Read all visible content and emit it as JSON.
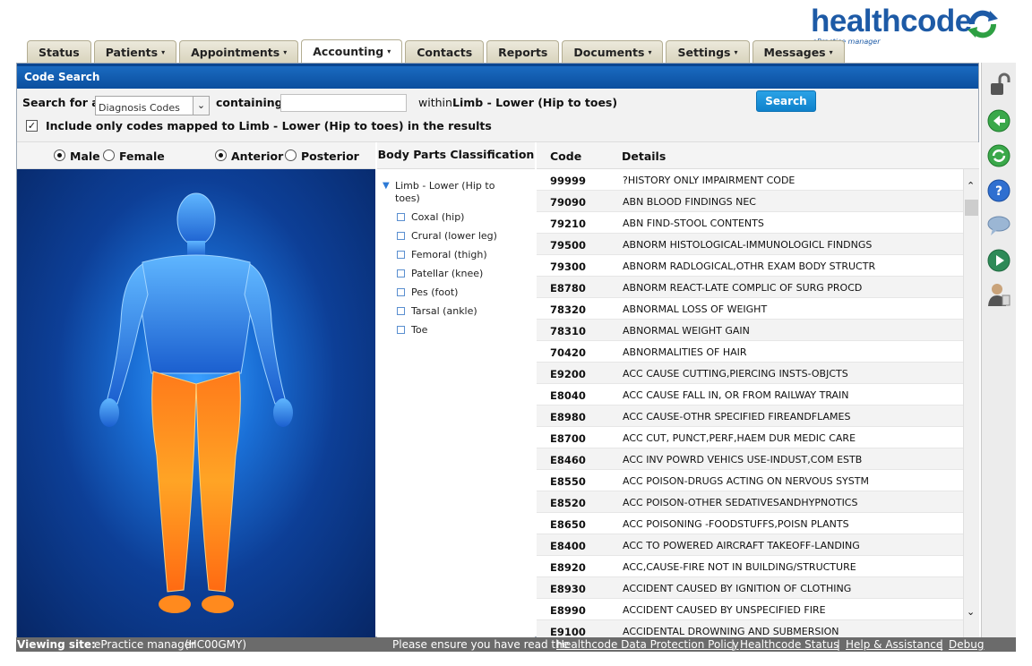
{
  "brand": {
    "name": "healthcode",
    "tagline": "ePractice manager",
    "colors": {
      "primary": "#1d5aa6",
      "accent": "#2ea043"
    }
  },
  "tabs": [
    {
      "label": "Status",
      "caret": false
    },
    {
      "label": "Patients",
      "caret": true
    },
    {
      "label": "Appointments",
      "caret": true
    },
    {
      "label": "Accounting",
      "caret": true,
      "active": true
    },
    {
      "label": "Contacts",
      "caret": false
    },
    {
      "label": "Reports",
      "caret": false
    },
    {
      "label": "Documents",
      "caret": true
    },
    {
      "label": "Settings",
      "caret": true
    },
    {
      "label": "Messages",
      "caret": true
    }
  ],
  "panel": {
    "title": "Code Search"
  },
  "search": {
    "search_for_label": "Search for a",
    "code_type_value": "Diagnosis Codes",
    "containing_label": "containing",
    "containing_value": "",
    "within_label": "within",
    "within_value": "Limb - Lower  (Hip to toes)",
    "button_label": "Search",
    "include_only_checked": true,
    "include_only_label": "Include only codes mapped to Limb - Lower  (Hip to toes) in the results"
  },
  "view": {
    "male_label": "Male",
    "female_label": "Female",
    "anterior_label": "Anterior",
    "posterior_label": "Posterior",
    "selected_gender": "male",
    "selected_view": "anterior"
  },
  "body_parts": {
    "header": "Body Parts Classification",
    "root": "Limb - Lower  (Hip to toes)",
    "items": [
      "Coxal (hip)",
      "Crural (lower leg)",
      "Femoral (thigh)",
      "Patellar (knee)",
      "Pes (foot)",
      "Tarsal (ankle)",
      "Toe"
    ]
  },
  "codes": {
    "code_header": "Code",
    "details_header": "Details",
    "rows": [
      {
        "code": "99999",
        "details": "?HISTORY ONLY IMPAIRMENT CODE"
      },
      {
        "code": "79090",
        "details": "ABN BLOOD FINDINGS NEC"
      },
      {
        "code": "79210",
        "details": "ABN FIND-STOOL CONTENTS"
      },
      {
        "code": "79500",
        "details": "ABNORM HISTOLOGICAL-IMMUNOLOGICL FINDNGS"
      },
      {
        "code": "79300",
        "details": "ABNORM RADLOGICAL,OTHR EXAM BODY STRUCTR"
      },
      {
        "code": "E8780",
        "details": "ABNORM REACT-LATE COMPLIC OF SURG PROCD"
      },
      {
        "code": "78320",
        "details": "ABNORMAL LOSS OF WEIGHT"
      },
      {
        "code": "78310",
        "details": "ABNORMAL WEIGHT GAIN"
      },
      {
        "code": "70420",
        "details": "ABNORMALITIES OF HAIR"
      },
      {
        "code": "E9200",
        "details": "ACC CAUSE CUTTING,PIERCING INSTS-OBJCTS"
      },
      {
        "code": "E8040",
        "details": "ACC CAUSE FALL IN, OR FROM RAILWAY TRAIN"
      },
      {
        "code": "E8980",
        "details": "ACC CAUSE-OTHR SPECIFIED FIREANDFLAMES"
      },
      {
        "code": "E8700",
        "details": "ACC CUT, PUNCT,PERF,HAEM DUR MEDIC CARE"
      },
      {
        "code": "E8460",
        "details": "ACC INV POWRD VEHICS USE-INDUST,COM ESTB"
      },
      {
        "code": "E8550",
        "details": "ACC POISON-DRUGS ACTING ON NERVOUS SYSTM"
      },
      {
        "code": "E8520",
        "details": "ACC POISON-OTHER SEDATIVESANDHYPNOTICS"
      },
      {
        "code": "E8650",
        "details": "ACC POISONING -FOODSTUFFS,POISN PLANTS"
      },
      {
        "code": "E8400",
        "details": "ACC TO POWERED AIRCRAFT TAKEOFF-LANDING"
      },
      {
        "code": "E8920",
        "details": "ACC,CAUSE-FIRE NOT IN BUILDING/STRUCTURE"
      },
      {
        "code": "E8930",
        "details": "ACCIDENT CAUSED BY IGNITION OF CLOTHING"
      },
      {
        "code": "E8990",
        "details": "ACCIDENT CAUSED BY UNSPECIFIED FIRE"
      },
      {
        "code": "E9100",
        "details": "ACCIDENTAL DROWNING AND SUBMERSION"
      }
    ]
  },
  "rail_icons": [
    "lock-open-icon",
    "back-icon",
    "refresh-icon",
    "help-icon",
    "chat-icon",
    "forward-icon",
    "user-icon"
  ],
  "footer": {
    "viewing_label": "Viewing site:",
    "site_name": "ePractice manager",
    "site_code": "(HC00GMY)",
    "notice": "Please ensure you have read the",
    "links": [
      "Healthcode Data Protection Policy",
      "Healthcode Status",
      "Help & Assistance",
      "Debug Mode"
    ]
  }
}
